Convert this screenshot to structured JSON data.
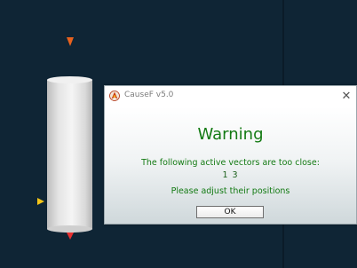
{
  "dialog": {
    "window_title": "CauseF v5.0",
    "close_glyph": "✕",
    "heading": "Warning",
    "message_line1": "The following active vectors are too close:",
    "message_vectors": "1   3",
    "message_line2": "Please adjust their positions",
    "ok_label": "OK"
  },
  "colors": {
    "background": "#0f2535",
    "message_green": "#137a13",
    "arrow_down": "#e8621e",
    "arrow_right": "#f5c518",
    "arrow_tip": "#9b30c8"
  },
  "icons": {
    "app_icon": "causef-logo-icon",
    "close_icon": "close-icon"
  }
}
